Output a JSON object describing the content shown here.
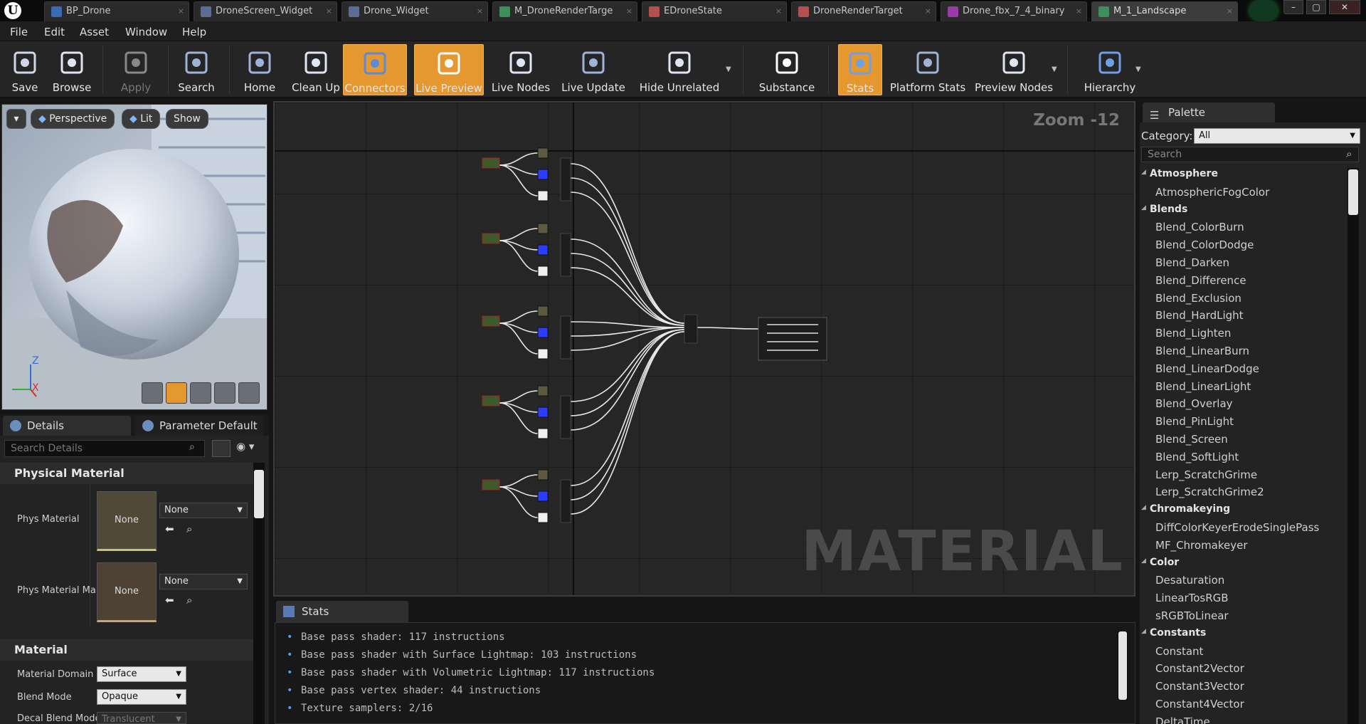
{
  "tabs": [
    {
      "label": "BP_Drone",
      "color": "#3c6bb5"
    },
    {
      "label": "DroneScreen_Widget",
      "color": "#5a6f8f"
    },
    {
      "label": "Drone_Widget",
      "color": "#5a6f8f"
    },
    {
      "label": "M_DroneRenderTarge",
      "color": "#3d8f5a"
    },
    {
      "label": "EDroneState",
      "color": "#b35050"
    },
    {
      "label": "DroneRenderTarget",
      "color": "#b35050"
    },
    {
      "label": "Drone_fbx_7_4_binary",
      "color": "#9a3aa8"
    },
    {
      "label": "M_1_Landscape",
      "color": "#3d8f5a"
    }
  ],
  "menu": [
    "File",
    "Edit",
    "Asset",
    "Window",
    "Help"
  ],
  "toolbar": [
    {
      "label": "Save",
      "icon": "save-icon",
      "state": "normal"
    },
    {
      "label": "Browse",
      "icon": "browse-icon",
      "state": "normal"
    },
    {
      "label": "Apply",
      "icon": "apply-icon",
      "state": "disabled"
    },
    {
      "label": "Search",
      "icon": "search-icon",
      "state": "normal"
    },
    {
      "label": "Home",
      "icon": "home-icon",
      "state": "normal"
    },
    {
      "label": "Clean Up",
      "icon": "cleanup-icon",
      "state": "normal"
    },
    {
      "label": "Connectors",
      "icon": "connectors-icon",
      "state": "active"
    },
    {
      "label": "Live Preview",
      "icon": "live-preview-icon",
      "state": "active"
    },
    {
      "label": "Live Nodes",
      "icon": "live-nodes-icon",
      "state": "normal"
    },
    {
      "label": "Live Update",
      "icon": "live-update-icon",
      "state": "normal"
    },
    {
      "label": "Hide Unrelated",
      "icon": "hide-unrelated-icon",
      "state": "normal"
    },
    {
      "label": "Substance",
      "icon": "substance-icon",
      "state": "normal"
    },
    {
      "label": "Stats",
      "icon": "stats-icon",
      "state": "active"
    },
    {
      "label": "Platform Stats",
      "icon": "platform-stats-icon",
      "state": "normal"
    },
    {
      "label": "Preview Nodes",
      "icon": "preview-nodes-icon",
      "state": "normal"
    },
    {
      "label": "Hierarchy",
      "icon": "hierarchy-icon",
      "state": "normal"
    }
  ],
  "viewport": {
    "perspective": "Perspective",
    "lit": "Lit",
    "show": "Show",
    "axis_z": "Z",
    "axis_x": "X"
  },
  "panels": {
    "details_tab": "Details",
    "param_tab": "Parameter Default"
  },
  "details": {
    "search_placeholder": "Search Details",
    "section_physical": "Physical Material",
    "phys_material_label": "Phys Material",
    "phys_material_thumb": "None",
    "phys_material_value": "None",
    "phys_mask_label": "Phys Material Ma",
    "phys_mask_thumb": "None",
    "phys_mask_value": "None",
    "section_material": "Material",
    "material_domain_label": "Material Domain",
    "material_domain_value": "Surface",
    "blend_mode_label": "Blend Mode",
    "blend_mode_value": "Opaque",
    "decal_blend_label": "Decal Blend Mode",
    "decal_blend_value": "Translucent"
  },
  "graph": {
    "zoom": "Zoom -12",
    "watermark": "MATERIAL"
  },
  "stats": {
    "tab": "Stats",
    "lines": [
      "Base pass shader: 117 instructions",
      "Base pass shader with Surface Lightmap: 103 instructions",
      "Base pass shader with Volumetric Lightmap: 117 instructions",
      "Base pass vertex shader: 44 instructions",
      "Texture samplers: 2/16"
    ]
  },
  "palette": {
    "tab": "Palette",
    "category_label": "Category:",
    "category_value": "All",
    "search_placeholder": "Search",
    "rows": [
      {
        "type": "hdr",
        "text": "Atmosphere"
      },
      {
        "type": "it",
        "text": "AtmosphericFogColor"
      },
      {
        "type": "hdr",
        "text": "Blends"
      },
      {
        "type": "it",
        "text": "Blend_ColorBurn"
      },
      {
        "type": "it",
        "text": "Blend_ColorDodge"
      },
      {
        "type": "it",
        "text": "Blend_Darken"
      },
      {
        "type": "it",
        "text": "Blend_Difference"
      },
      {
        "type": "it",
        "text": "Blend_Exclusion"
      },
      {
        "type": "it",
        "text": "Blend_HardLight"
      },
      {
        "type": "it",
        "text": "Blend_Lighten"
      },
      {
        "type": "it",
        "text": "Blend_LinearBurn"
      },
      {
        "type": "it",
        "text": "Blend_LinearDodge"
      },
      {
        "type": "it",
        "text": "Blend_LinearLight"
      },
      {
        "type": "it",
        "text": "Blend_Overlay"
      },
      {
        "type": "it",
        "text": "Blend_PinLight"
      },
      {
        "type": "it",
        "text": "Blend_Screen"
      },
      {
        "type": "it",
        "text": "Blend_SoftLight"
      },
      {
        "type": "it",
        "text": "Lerp_ScratchGrime"
      },
      {
        "type": "it",
        "text": "Lerp_ScratchGrime2"
      },
      {
        "type": "hdr",
        "text": "Chromakeying"
      },
      {
        "type": "it",
        "text": "DiffColorKeyerErodeSinglePass"
      },
      {
        "type": "it",
        "text": "MF_Chromakeyer"
      },
      {
        "type": "hdr",
        "text": "Color"
      },
      {
        "type": "it",
        "text": "Desaturation"
      },
      {
        "type": "it",
        "text": "LinearTosRGB"
      },
      {
        "type": "it",
        "text": "sRGBToLinear"
      },
      {
        "type": "hdr",
        "text": "Constants"
      },
      {
        "type": "it",
        "text": "Constant",
        "key": "1"
      },
      {
        "type": "it",
        "text": "Constant2Vector",
        "key": "2"
      },
      {
        "type": "it",
        "text": "Constant3Vector",
        "key": "3"
      },
      {
        "type": "it",
        "text": "Constant4Vector",
        "key": "4"
      },
      {
        "type": "it",
        "text": "DeltaTime"
      }
    ]
  }
}
